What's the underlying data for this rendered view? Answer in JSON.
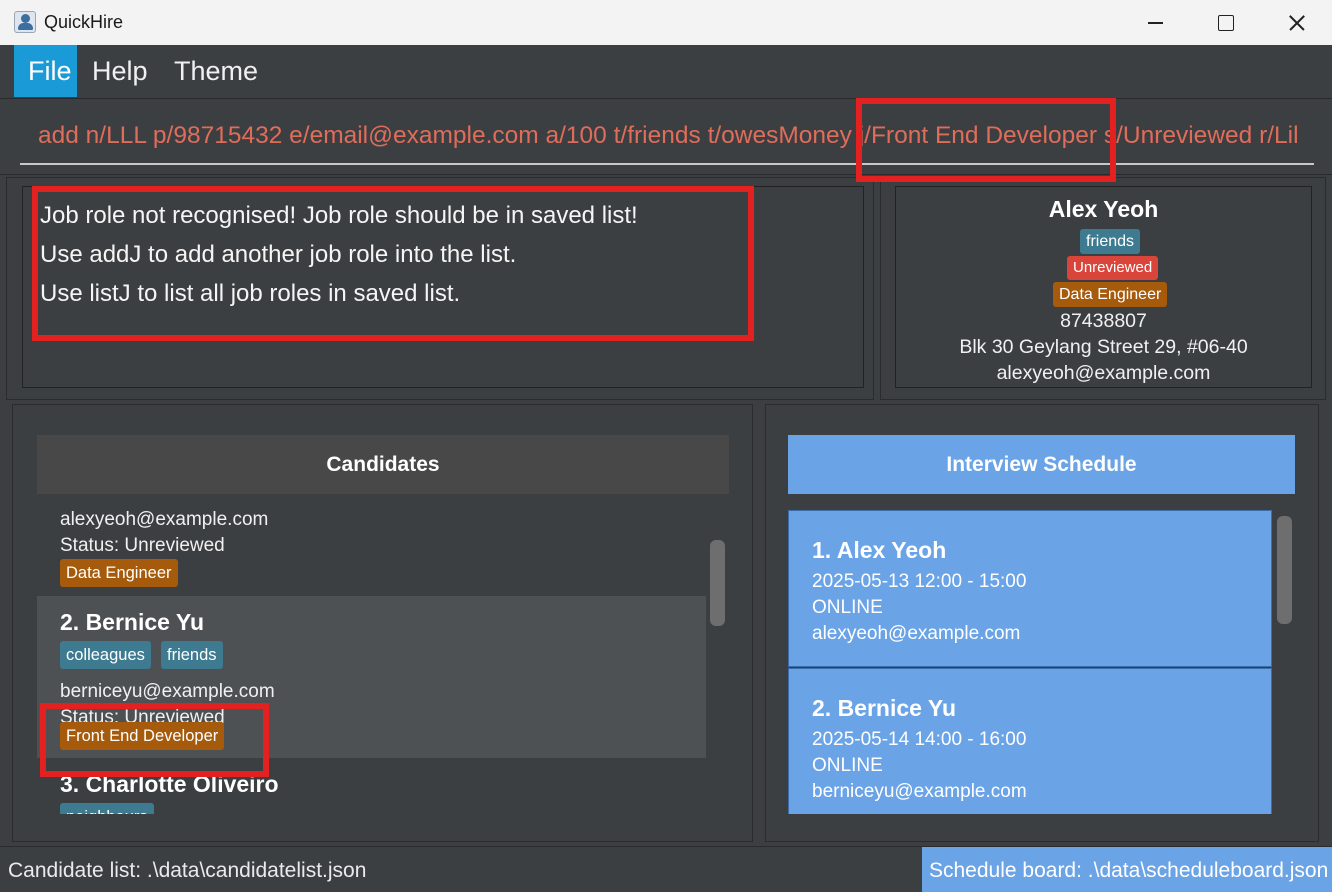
{
  "window": {
    "title": "QuickHire",
    "icon": "quickhire-logo-icon"
  },
  "menu": {
    "items": [
      "File",
      "Help",
      "Theme"
    ]
  },
  "command": {
    "value": "add n/LLL p/98715432 e/email@example.com a/100 t/friends t/owesMoney j/Front End Developer s/Unreviewed r/Lil"
  },
  "result": {
    "lines": [
      "Job role not recognised! Job role should be in saved list!",
      "Use addJ to add another job role into the list.",
      "Use listJ to list all job roles in saved list."
    ]
  },
  "detail": {
    "name": "Alex Yeoh",
    "tag": "friends",
    "status": "Unreviewed",
    "job": "Data Engineer",
    "phone": "87438807",
    "address": "Blk 30 Geylang Street 29, #06-40",
    "email": "alexyeoh@example.com"
  },
  "candidates": {
    "header": "Candidates",
    "items": [
      {
        "email": "alexyeoh@example.com",
        "status": "Status: Unreviewed",
        "job": "Data Engineer"
      },
      {
        "name": "2. Bernice Yu",
        "tags": [
          "colleagues",
          "friends"
        ],
        "email": "berniceyu@example.com",
        "status": "Status: Unreviewed",
        "job": "Front End Developer"
      },
      {
        "name": "3. Charlotte Oliveiro",
        "tags": [
          "neighbours"
        ]
      }
    ]
  },
  "schedule": {
    "header": "Interview Schedule",
    "items": [
      {
        "name": "1. Alex Yeoh",
        "time": "2025-05-13  12:00 - 15:00",
        "mode": "ONLINE",
        "email": "alexyeoh@example.com"
      },
      {
        "name": "2. Bernice Yu",
        "time": "2025-05-14  14:00 - 16:00",
        "mode": "ONLINE",
        "email": "berniceyu@example.com"
      }
    ]
  },
  "status": {
    "left": "Candidate list: .\\data\\candidatelist.json",
    "right": "Schedule board: .\\data\\scheduleboard.json"
  },
  "colors": {
    "accent": "#1a9ad6",
    "schedule_blue": "#6aa3e6",
    "tag_blue": "#3e7b91",
    "tag_orange": "#a55a0c",
    "status_red": "#d9453b",
    "command_text": "#e06c5a",
    "highlight": "#e42121"
  }
}
